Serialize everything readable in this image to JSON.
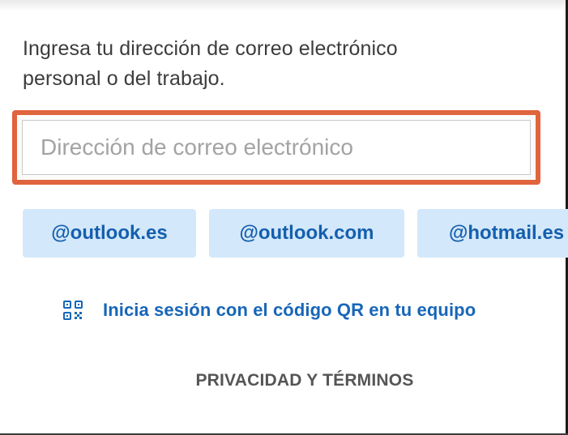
{
  "instruction": {
    "line1": "Ingresa tu dirección de correo electrónico",
    "line2": "personal o del trabajo."
  },
  "email_input": {
    "placeholder": "Dirección de correo electrónico",
    "value": "",
    "highlight_color": "#e0643e"
  },
  "domain_chips": [
    {
      "label": "@outlook.es"
    },
    {
      "label": "@outlook.com"
    },
    {
      "label": "@hotmail.es"
    }
  ],
  "qr_signin": {
    "icon": "qr-code-icon",
    "label": "Inicia sesión con el código QR en tu equipo"
  },
  "footer": {
    "privacy_terms_label": "PRIVACIDAD Y TÉRMINOS"
  },
  "colors": {
    "chip_background": "#d3e8fa",
    "link_blue": "#1766b8"
  }
}
